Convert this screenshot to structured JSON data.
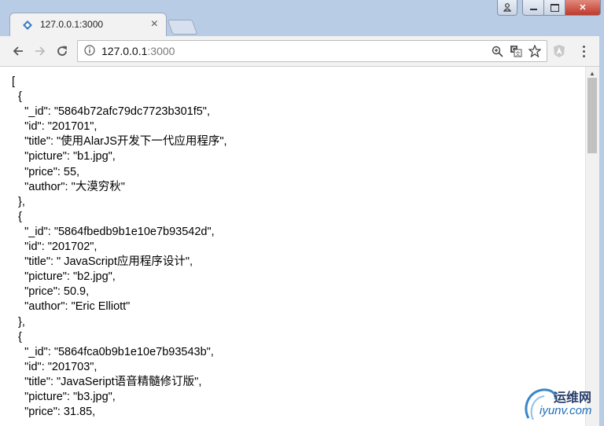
{
  "tab": {
    "title": "127.0.0.1:3000",
    "close_glyph": "×"
  },
  "window_controls": {
    "user_glyph": "👤",
    "minimize_glyph": "—",
    "maximize_glyph": "▢",
    "close_glyph": "✕"
  },
  "toolbar": {
    "back_glyph": "←",
    "forward_glyph": "→",
    "reload_glyph": "↻",
    "url_host": "127.0.0.1",
    "url_port": ":3000",
    "zoom_glyph": "🔍",
    "translate_glyph": "⌘",
    "star_glyph": "☆"
  },
  "content": {
    "json_text": "[\n  {\n    \"_id\": \"5864b72afc79dc7723b301f5\",\n    \"id\": \"201701\",\n    \"title\": \"使用AlarJS开发下一代应用程序\",\n    \"picture\": \"b1.jpg\",\n    \"price\": 55,\n    \"author\": \"大漠穷秋\"\n  },\n  {\n    \"_id\": \"5864fbedb9b1e10e7b93542d\",\n    \"id\": \"201702\",\n    \"title\": \" JavaScript应用程序设计\",\n    \"picture\": \"b2.jpg\",\n    \"price\": 50.9,\n    \"author\": \"Eric Elliott\"\n  },\n  {\n    \"_id\": \"5864fca0b9b1e10e7b93543b\",\n    \"id\": \"201703\",\n    \"title\": \"JavaSeript语音精髓修订版\",\n    \"picture\": \"b3.jpg\",\n    \"price\": 31.85,"
  },
  "watermark": {
    "cn": "运维网",
    "en": "iyunv.com"
  },
  "colors": {
    "titlebar": "#b9cce6",
    "toolbar": "#f2f2f2",
    "close_button": "#c0392b"
  }
}
